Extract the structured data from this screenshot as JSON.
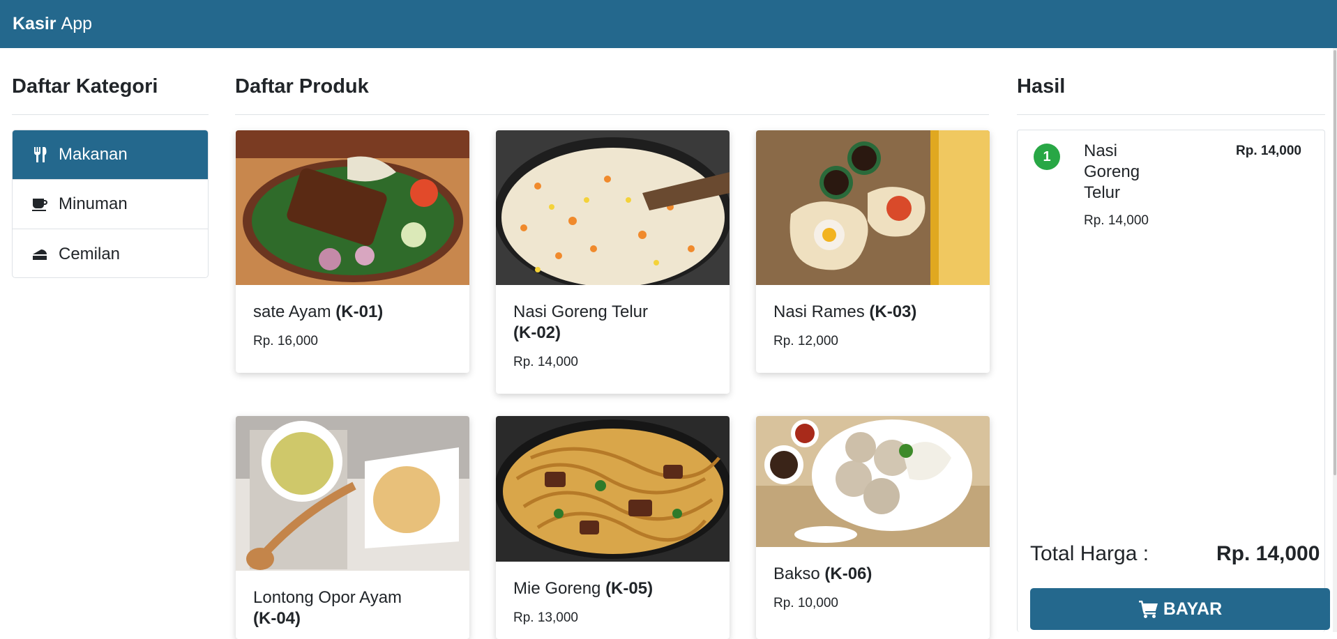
{
  "navbar": {
    "brand_bold": "Kasir",
    "brand_rest": "App"
  },
  "categories": {
    "title": "Daftar Kategori",
    "items": [
      {
        "label": "Makanan",
        "icon": "utensils-icon",
        "active": true
      },
      {
        "label": "Minuman",
        "icon": "coffee-cup-icon",
        "active": false
      },
      {
        "label": "Cemilan",
        "icon": "cake-slice-icon",
        "active": false
      }
    ]
  },
  "products": {
    "title": "Daftar Produk",
    "items": [
      {
        "name": "sate Ayam",
        "code": "(K-01)",
        "price": "Rp. 16,000",
        "image": "sate-ayam-image"
      },
      {
        "name": "Nasi Goreng Telur",
        "code": "(K-02)",
        "price": "Rp. 14,000",
        "image": "nasi-goreng-image"
      },
      {
        "name": "Nasi Rames",
        "code": "(K-03)",
        "price": "Rp. 12,000",
        "image": "nasi-rames-image"
      },
      {
        "name": "Lontong Opor Ayam",
        "code": "(K-04)",
        "price": "",
        "image": "lontong-opor-image"
      },
      {
        "name": "Mie Goreng",
        "code": "(K-05)",
        "price": "Rp. 13,000",
        "image": "mie-goreng-image"
      },
      {
        "name": "Bakso",
        "code": "(K-06)",
        "price": "Rp. 10,000",
        "image": "bakso-image"
      }
    ]
  },
  "result": {
    "title": "Hasil",
    "orders": [
      {
        "qty": "1",
        "name": "Nasi Goreng Telur",
        "unit_price": "Rp. 14,000",
        "total": "Rp. 14,000"
      }
    ],
    "total_label": "Total Harga :",
    "total_value": "Rp. 14,000",
    "pay_label": "BAYAR"
  },
  "colors": {
    "primary": "#24688d",
    "badge": "#28a745",
    "border": "#dee2e6"
  }
}
